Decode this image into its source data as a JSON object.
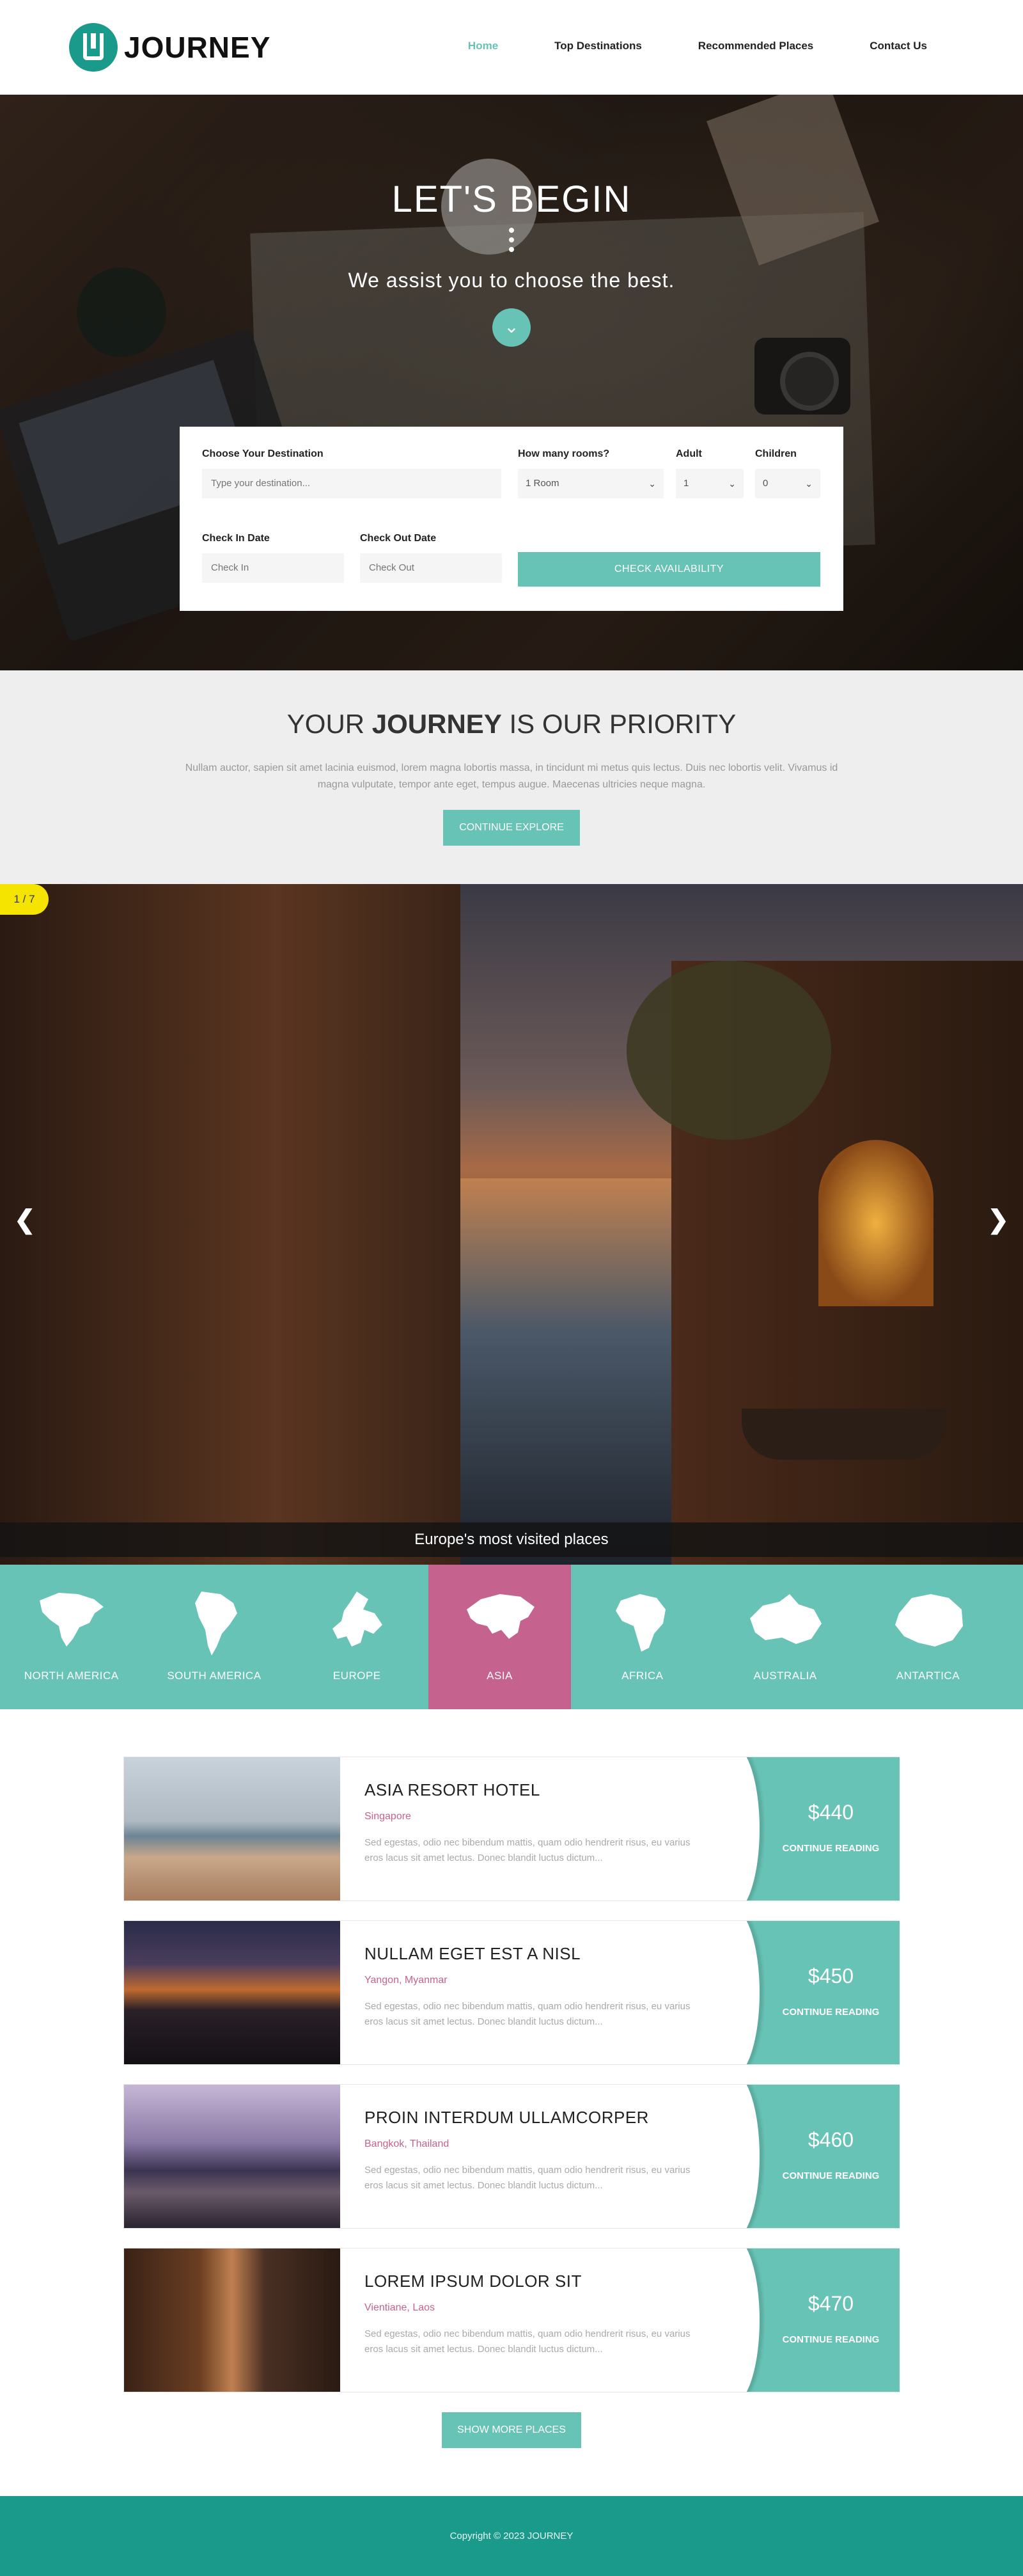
{
  "brand": {
    "name": "JOURNEY"
  },
  "nav": {
    "items": [
      {
        "label": "Home",
        "active": true
      },
      {
        "label": "Top Destinations"
      },
      {
        "label": "Recommended Places"
      },
      {
        "label": "Contact Us"
      }
    ]
  },
  "hero": {
    "title": "LET'S BEGIN",
    "subtitle": "We assist you to choose the best."
  },
  "booking": {
    "destination_label": "Choose Your Destination",
    "destination_placeholder": "Type your destination...",
    "rooms_label": "How many rooms?",
    "rooms_value": "1 Room",
    "adult_label": "Adult",
    "adult_value": "1",
    "children_label": "Children",
    "children_value": "0",
    "checkin_label": "Check In Date",
    "checkin_placeholder": "Check In",
    "checkout_label": "Check Out Date",
    "checkout_placeholder": "Check Out",
    "submit_label": "CHECK AVAILABILITY"
  },
  "priority": {
    "title_pre": "YOUR ",
    "title_bold": "JOURNEY",
    "title_post": " IS OUR PRIORITY",
    "text": "Nullam auctor, sapien sit amet lacinia euismod, lorem magna lobortis massa, in tincidunt mi metus quis lectus. Duis nec lobortis velit. Vivamus id magna vulputate, tempor ante eget, tempus augue. Maecenas ultricies neque magna.",
    "button_label": "CONTINUE EXPLORE"
  },
  "slider": {
    "counter": "1 / 7",
    "prev_icon": "chevron-left-icon",
    "next_icon": "chevron-right-icon",
    "caption": "Europe's most visited places"
  },
  "continents": [
    {
      "label": "NORTH AMERICA"
    },
    {
      "label": "SOUTH AMERICA"
    },
    {
      "label": "EUROPE"
    },
    {
      "label": "ASIA",
      "active": true
    },
    {
      "label": "AFRICA"
    },
    {
      "label": "AUSTRALIA"
    },
    {
      "label": "ANTARTICA"
    }
  ],
  "listings": [
    {
      "title": "ASIA RESORT HOTEL",
      "location": "Singapore",
      "description": "Sed egestas, odio nec bibendum mattis, quam odio hendrerit risus, eu varius eros lacus sit amet lectus. Donec blandit luctus dictum...",
      "price": "$440",
      "cta": "CONTINUE READING"
    },
    {
      "title": "NULLAM EGET EST A NISL",
      "location": "Yangon, Myanmar",
      "description": "Sed egestas, odio nec bibendum mattis, quam odio hendrerit risus, eu varius eros lacus sit amet lectus. Donec blandit luctus dictum...",
      "price": "$450",
      "cta": "CONTINUE READING"
    },
    {
      "title": "PROIN INTERDUM ULLAMCORPER",
      "location": "Bangkok, Thailand",
      "description": "Sed egestas, odio nec bibendum mattis, quam odio hendrerit risus, eu varius eros lacus sit amet lectus. Donec blandit luctus dictum...",
      "price": "$460",
      "cta": "CONTINUE READING"
    },
    {
      "title": "LOREM IPSUM DOLOR SIT",
      "location": "Vientiane, Laos",
      "description": "Sed egestas, odio nec bibendum mattis, quam odio hendrerit risus, eu varius eros lacus sit amet lectus. Donec blandit luctus dictum...",
      "price": "$470",
      "cta": "CONTINUE READING"
    }
  ],
  "show_more_label": "SHOW MORE PLACES",
  "footer": {
    "copyright": "Copyright © 2023 JOURNEY"
  },
  "colors": {
    "accent": "#67c3b5",
    "brand": "#1a9a8a",
    "highlight": "#c6628e",
    "counter": "#f5e300"
  }
}
